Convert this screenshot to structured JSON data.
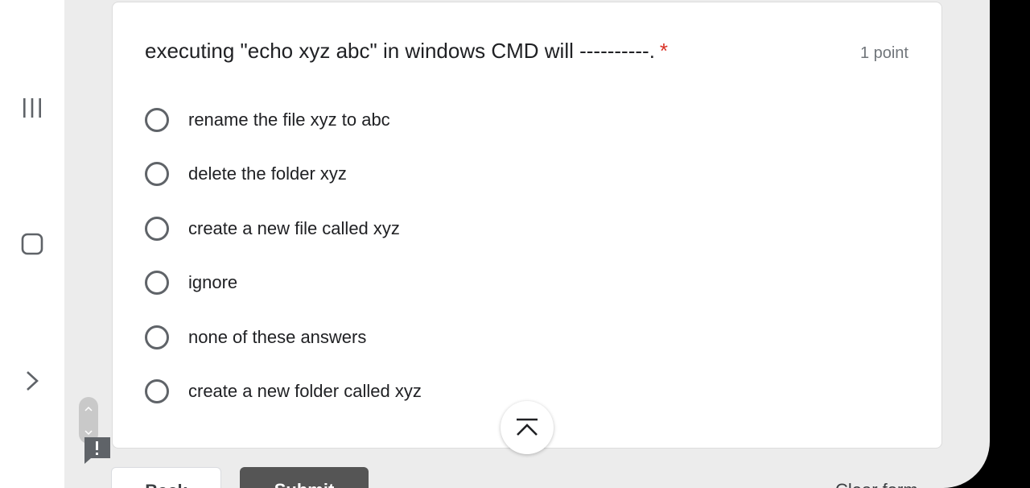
{
  "question": {
    "text": "executing \"echo xyz abc\" in windows CMD will ----------.",
    "required_marker": "*",
    "points": "1 point"
  },
  "options": [
    {
      "label": "rename the file xyz to abc",
      "selected": false
    },
    {
      "label": "delete the folder xyz",
      "selected": false
    },
    {
      "label": "create a new file called xyz",
      "selected": false
    },
    {
      "label": "ignore",
      "selected": false
    },
    {
      "label": "none of these answers",
      "selected": false
    },
    {
      "label": "create a new folder called xyz",
      "selected": false
    }
  ],
  "buttons": {
    "back": "Back",
    "submit": "Submit",
    "clear_form": "Clear form"
  },
  "icons": {
    "recents": "recents-icon",
    "home": "home-icon",
    "back": "back-chevron-icon",
    "scroll_top": "scroll-to-top-icon",
    "feedback": "report-feedback-icon"
  },
  "colors": {
    "required": "#d93025",
    "submit_bg": "#555555"
  }
}
